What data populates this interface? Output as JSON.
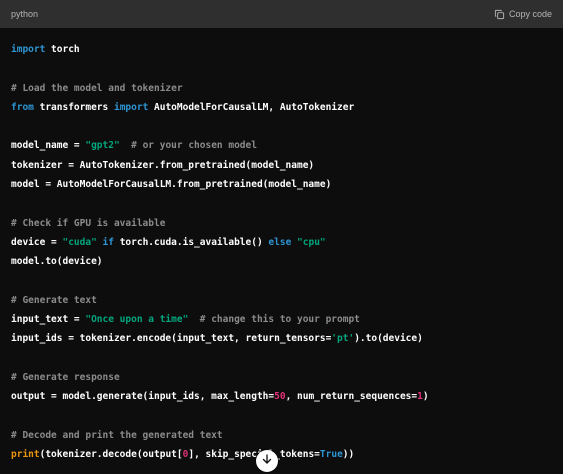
{
  "header": {
    "language": "python",
    "copy_label": "Copy code"
  },
  "code": {
    "import_kw": "import",
    "import_torch": " torch",
    "comment_load": "# Load the model and tokenizer",
    "from_kw": "from",
    "from_mod": " transformers ",
    "from_import_kw": "import",
    "from_rest": " AutoModelForCausalLM, AutoTokenizer",
    "model_name_lhs": "model_name = ",
    "model_name_str": "\"gpt2\"",
    "model_name_comment": "  # or your chosen model",
    "tokenizer_line": "tokenizer = AutoTokenizer.from_pretrained(model_name)",
    "model_line": "model = AutoModelForCausalLM.from_pretrained(model_name)",
    "comment_gpu": "# Check if GPU is available",
    "device_lhs": "device = ",
    "device_cuda": "\"cuda\"",
    "device_if": " if ",
    "device_cond": "torch.cuda.is_available() ",
    "device_else": "else",
    "device_sp": " ",
    "device_cpu": "\"cpu\"",
    "model_to": "model.to(device)",
    "comment_generate": "# Generate text",
    "input_text_lhs": "input_text = ",
    "input_text_str": "\"Once upon a time\"",
    "input_text_comment": "  # change this to your prompt",
    "input_ids_lhs": "input_ids = tokenizer.encode(input_text, return_tensors=",
    "input_ids_str": "'pt'",
    "input_ids_rest": ").to(device)",
    "comment_response": "# Generate response",
    "output_lhs": "output = model.generate(input_ids, max_length=",
    "output_maxlen": "50",
    "output_mid": ", num_return_sequences=",
    "output_nrs": "1",
    "output_end": ")",
    "comment_decode": "# Decode and print the generated text",
    "print_fn": "print",
    "print_mid": "(tokenizer.decode(output[",
    "print_idx": "0",
    "print_mid2": "], skip_special_tokens=",
    "print_true": "True",
    "print_end": "))"
  },
  "icons": {
    "copy": "copy-icon",
    "scroll_down": "arrow-down-icon"
  },
  "colors": {
    "background": "#0d0d0d",
    "header": "#2f2f2f",
    "keyword": "#2e95d3",
    "string": "#00a67d",
    "comment": "#8b8b8b",
    "number": "#df3079",
    "builtin": "#e9950c"
  }
}
